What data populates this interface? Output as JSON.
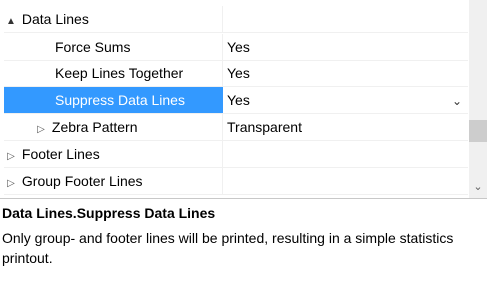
{
  "grid": {
    "rows": [
      {
        "name": "Data Lines",
        "value": "",
        "expander": "▲"
      },
      {
        "name": "Force Sums",
        "value": "Yes"
      },
      {
        "name": "Keep Lines Together",
        "value": "Yes"
      },
      {
        "name": "Suppress Data Lines",
        "value": "Yes",
        "selected": true
      },
      {
        "name": "Zebra Pattern",
        "value": "Transparent",
        "expander": "▷"
      },
      {
        "name": "Footer Lines",
        "value": "",
        "expander": "▷"
      },
      {
        "name": "Group Footer Lines",
        "value": "",
        "expander": "▷"
      }
    ],
    "dropdown_icon": "chevron-down"
  },
  "description": {
    "title": "Data Lines.Suppress Data Lines",
    "text": "Only group- and footer lines will be printed, resulting in a simple statistics printout."
  },
  "colors": {
    "selected": "#3399ff",
    "gridline": "#f0f0f0"
  }
}
